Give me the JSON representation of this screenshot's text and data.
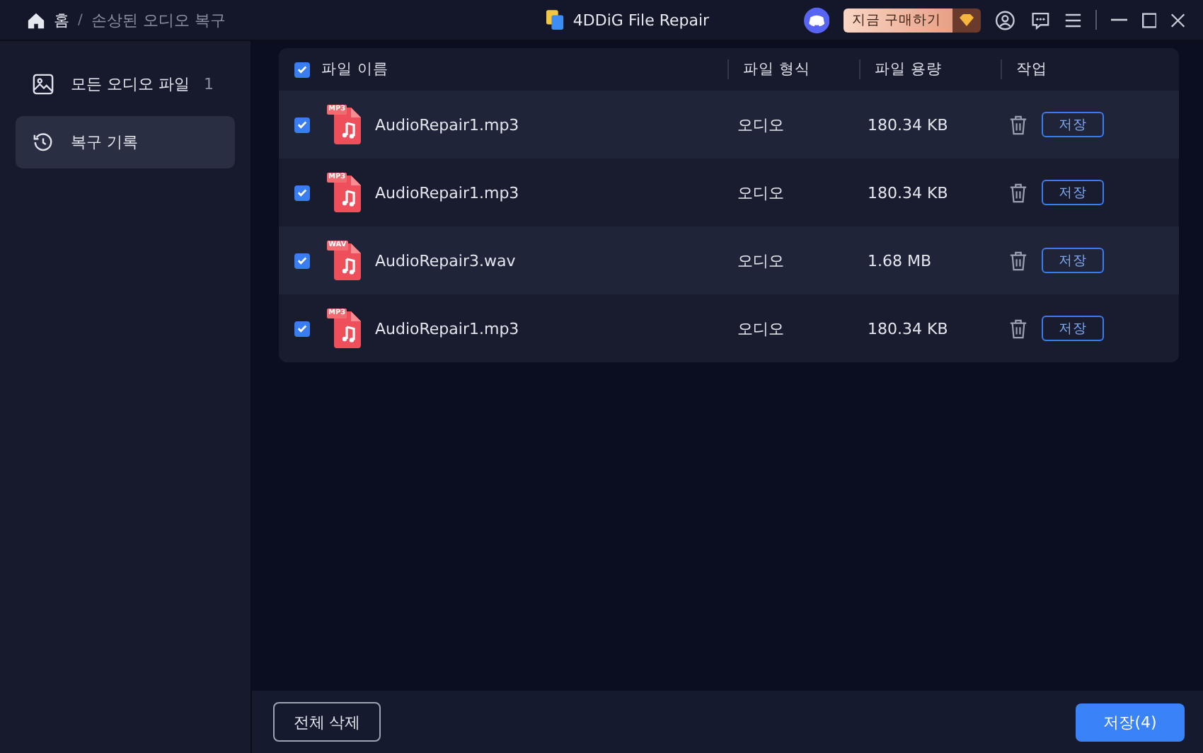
{
  "breadcrumb": {
    "home": "홈",
    "separator": "/",
    "current": "손상된 오디오 복구"
  },
  "app_title": "4DDiG File Repair",
  "buy_button": "지금 구매하기",
  "sidebar": {
    "items": [
      {
        "label": "모든 오디오 파일",
        "count": "1",
        "selected": false,
        "kind": "image"
      },
      {
        "label": "복구 기록",
        "selected": true,
        "kind": "history"
      }
    ]
  },
  "table": {
    "all_checked": true,
    "columns": [
      "파일 이름",
      "파일 형식",
      "파일 용량",
      "작업"
    ],
    "rows": [
      {
        "checked": true,
        "badge": "MP3",
        "name": "AudioRepair1.mp3",
        "type": "오디오",
        "size": "180.34 KB",
        "action": "저장"
      },
      {
        "checked": true,
        "badge": "MP3",
        "name": "AudioRepair1.mp3",
        "type": "오디오",
        "size": "180.34 KB",
        "action": "저장"
      },
      {
        "checked": true,
        "badge": "WAV",
        "name": "AudioRepair3.wav",
        "type": "오디오",
        "size": "1.68 MB",
        "action": "저장"
      },
      {
        "checked": true,
        "badge": "MP3",
        "name": "AudioRepair1.mp3",
        "type": "오디오",
        "size": "180.34 KB",
        "action": "저장"
      }
    ]
  },
  "footer": {
    "delete_all": "전체 삭제",
    "save": "저장(4)"
  }
}
